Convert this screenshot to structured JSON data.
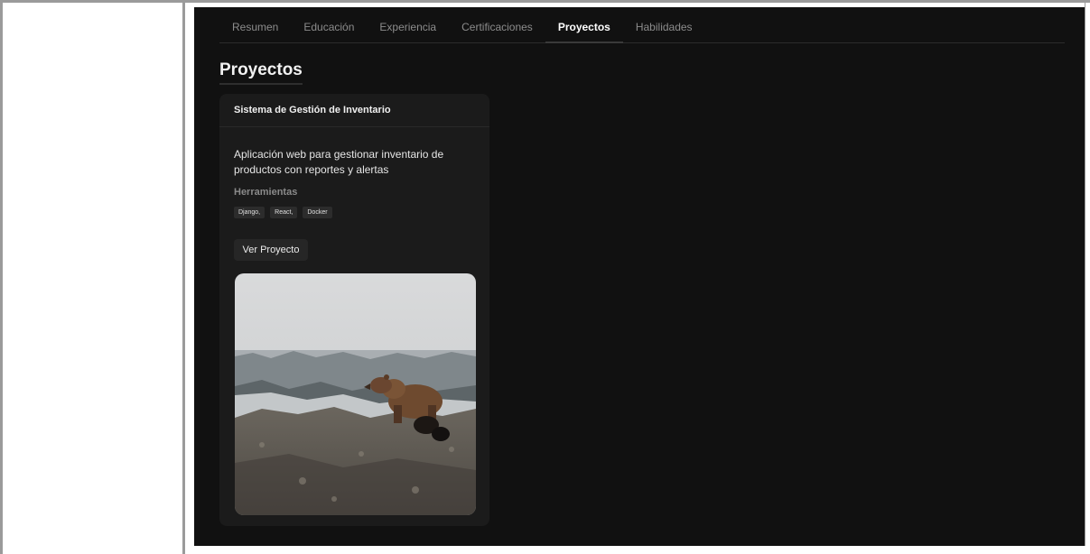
{
  "tabs": [
    {
      "label": "Resumen",
      "active": false
    },
    {
      "label": "Educación",
      "active": false
    },
    {
      "label": "Experiencia",
      "active": false
    },
    {
      "label": "Certificaciones",
      "active": false
    },
    {
      "label": "Proyectos",
      "active": true
    },
    {
      "label": "Habilidades",
      "active": false
    }
  ],
  "section": {
    "title": "Proyectos"
  },
  "project": {
    "name": "Sistema de Gestión de Inventario",
    "description": "Aplicación web para gestionar inventario de productos con reportes y alertas",
    "tools_heading": "Herramientas",
    "tools": [
      "Django,",
      "React,",
      "Docker"
    ],
    "view_button": "Ver Proyecto",
    "image_subject": "bear-photo"
  },
  "colors": {
    "background": "#111111",
    "card": "#1b1b1b",
    "tag": "#2c2c2c",
    "frame": "#9a9a9a"
  }
}
